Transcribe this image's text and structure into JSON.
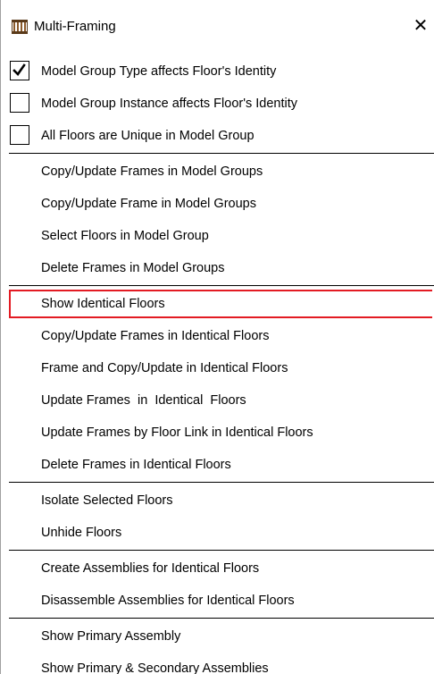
{
  "title": "Multi-Framing",
  "title_icon": "multi-framing-icon",
  "close_symbol": "✕",
  "highlight_color": "#e31b23",
  "checkboxes": [
    {
      "label": "Model Group Type affects Floor's Identity",
      "checked": true
    },
    {
      "label": "Model Group Instance affects Floor's Identity",
      "checked": false
    },
    {
      "label": "All Floors are Unique in Model Group",
      "checked": false
    }
  ],
  "group1": [
    "Copy/Update Frames in Model Groups",
    "Copy/Update Frame in Model Groups",
    "Select Floors in Model Group",
    "Delete Frames in Model Groups"
  ],
  "group2": [
    "Show Identical Floors",
    "Copy/Update Frames in Identical Floors",
    "Frame and Copy/Update in Identical Floors",
    "Update Frames  in  Identical  Floors",
    "Update Frames by Floor Link in Identical Floors",
    "Delete Frames in Identical Floors"
  ],
  "group3": [
    "Isolate Selected Floors",
    "Unhide Floors"
  ],
  "group4": [
    "Create Assemblies for Identical Floors",
    "Disassemble Assemblies for Identical Floors"
  ],
  "group5": [
    "Show Primary Assembly",
    "Show Primary & Secondary Assemblies"
  ]
}
